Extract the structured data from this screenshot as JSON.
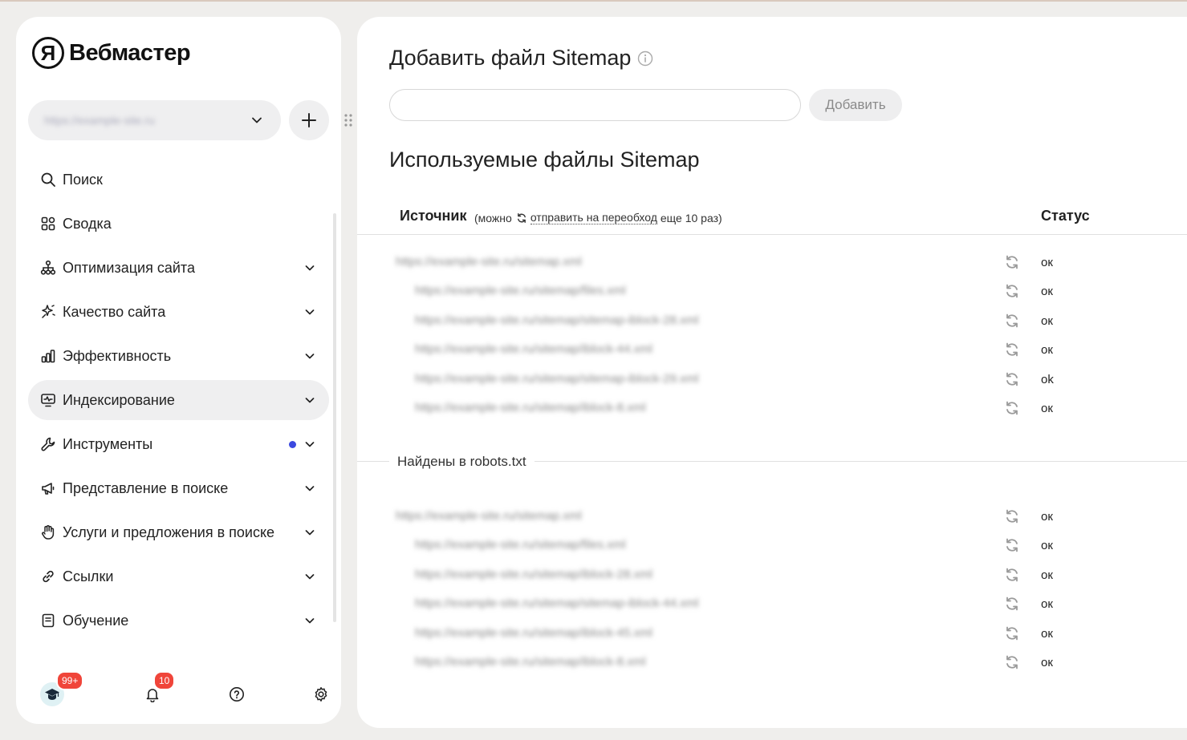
{
  "app": {
    "logo_letter": "Я",
    "logo_text": "Вебмастер"
  },
  "site_selector": {
    "current_site": "https://example-site.ru"
  },
  "nav": [
    {
      "label": "Поиск",
      "icon": "search-icon",
      "chevron": false,
      "dot": false,
      "active": false
    },
    {
      "label": "Сводка",
      "icon": "dashboard-icon",
      "chevron": false,
      "dot": false,
      "active": false
    },
    {
      "label": "Оптимизация сайта",
      "icon": "sitemap-tree-icon",
      "chevron": true,
      "dot": false,
      "active": false
    },
    {
      "label": "Качество сайта",
      "icon": "sparkle-icon",
      "chevron": true,
      "dot": false,
      "active": false
    },
    {
      "label": "Эффективность",
      "icon": "bar-chart-icon",
      "chevron": true,
      "dot": false,
      "active": false
    },
    {
      "label": "Индексирование",
      "icon": "monitor-pulse-icon",
      "chevron": true,
      "dot": false,
      "active": true
    },
    {
      "label": "Инструменты",
      "icon": "wrench-icon",
      "chevron": true,
      "dot": true,
      "active": false
    },
    {
      "label": "Представление в поиске",
      "icon": "megaphone-icon",
      "chevron": true,
      "dot": false,
      "active": false
    },
    {
      "label": "Услуги и предложения в поиске",
      "icon": "hand-icon",
      "chevron": true,
      "dot": false,
      "active": false
    },
    {
      "label": "Ссылки",
      "icon": "link-icon",
      "chevron": true,
      "dot": false,
      "active": false
    },
    {
      "label": "Обучение",
      "icon": "book-icon",
      "chevron": true,
      "dot": false,
      "active": false
    }
  ],
  "bottom_bar": {
    "learning_badge": "99+",
    "notifications_badge": "10"
  },
  "main": {
    "add_title": "Добавить файл Sitemap",
    "input_value": "",
    "add_button": "Добавить",
    "used_title": "Используемые файлы Sitemap",
    "col_source": "Источник",
    "note_prefix": "(можно",
    "note_link": "отправить на переобход",
    "note_suffix": "еще 10 раз)",
    "col_status": "Статус",
    "section_robots": "Найдены в robots.txt"
  },
  "group1": [
    {
      "url": "https://example-site.ru/sitemap.xml",
      "status": "ок",
      "child": false
    },
    {
      "url": "https://example-site.ru/sitemap/files.xml",
      "status": "ок",
      "child": true
    },
    {
      "url": "https://example-site.ru/sitemap/sitemap-iblock-28.xml",
      "status": "ок",
      "child": true
    },
    {
      "url": "https://example-site.ru/sitemap/iblock-44.xml",
      "status": "ок",
      "child": true
    },
    {
      "url": "https://example-site.ru/sitemap/sitemap-iblock-29.xml",
      "status": "ok",
      "child": true
    },
    {
      "url": "https://example-site.ru/sitemap/iblock-8.xml",
      "status": "ок",
      "child": true
    }
  ],
  "group2": [
    {
      "url": "https://example-site.ru/sitemap.xml",
      "status": "ок",
      "child": false
    },
    {
      "url": "https://example-site.ru/sitemap/files.xml",
      "status": "ок",
      "child": true
    },
    {
      "url": "https://example-site.ru/sitemap/iblock-28.xml",
      "status": "ок",
      "child": true
    },
    {
      "url": "https://example-site.ru/sitemap/sitemap-iblock-44.xml",
      "status": "ок",
      "child": true
    },
    {
      "url": "https://example-site.ru/sitemap/iblock-45.xml",
      "status": "ок",
      "child": true
    },
    {
      "url": "https://example-site.ru/sitemap/iblock-8.xml",
      "status": "ок",
      "child": true
    }
  ]
}
